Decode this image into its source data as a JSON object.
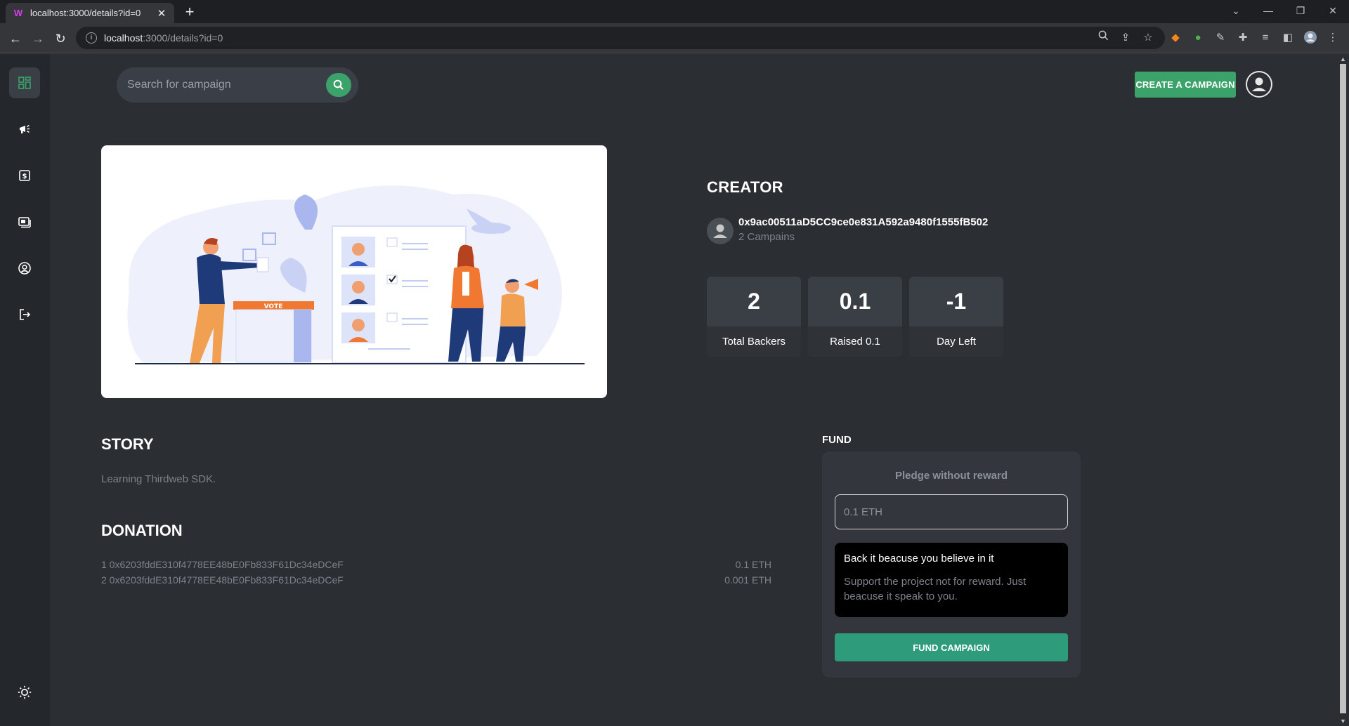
{
  "browser": {
    "tab_title": "localhost:3000/details?id=0",
    "tab_close": "✕",
    "new_tab": "+",
    "url_host": "localhost",
    "url_path": ":3000/details?id=0"
  },
  "search": {
    "placeholder": "Search for campaign"
  },
  "header": {
    "create_label": "CREATE A CAMPAIGN"
  },
  "creator": {
    "heading": "CREATOR",
    "address": "0x9ac00511aD5CC9ce0e831A592a9480f1555fB502",
    "campaigns": "2 Campains"
  },
  "stats": [
    {
      "value": "2",
      "label": "Total Backers"
    },
    {
      "value": "0.1",
      "label": "Raised 0.1"
    },
    {
      "value": "-1",
      "label": "Day Left"
    }
  ],
  "story": {
    "heading": "STORY",
    "text": "Learning Thirdweb SDK."
  },
  "donation": {
    "heading": "DONATION",
    "rows": [
      {
        "donor": "1 0x6203fddE310f4778EE48bE0Fb833F61Dc34eDCeF",
        "amount": "0.1 ETH"
      },
      {
        "donor": "2 0x6203fddE310f4778EE48bE0Fb833F61Dc34eDCeF",
        "amount": "0.001 ETH"
      }
    ]
  },
  "fund": {
    "heading": "FUND",
    "pledge_title": "Pledge without reward",
    "amount_placeholder": "0.1 ETH",
    "believe_title": "Back it beacuse you believe in it",
    "believe_text": "Support the project not for reward. Just beacuse it speak to you.",
    "button_label": "FUND CAMPAIGN"
  },
  "hero": {
    "vote_label": "VOTE"
  },
  "colors": {
    "accent": "#3ba36a",
    "fund_button": "#2e9c7a",
    "background": "#2b2e33",
    "sidebar": "#24272b"
  },
  "icons": {
    "sidebar": [
      "dashboard-icon",
      "megaphone-icon",
      "payment-icon",
      "withdraw-icon",
      "profile-icon",
      "logout-icon"
    ],
    "theme": "sun-icon"
  }
}
